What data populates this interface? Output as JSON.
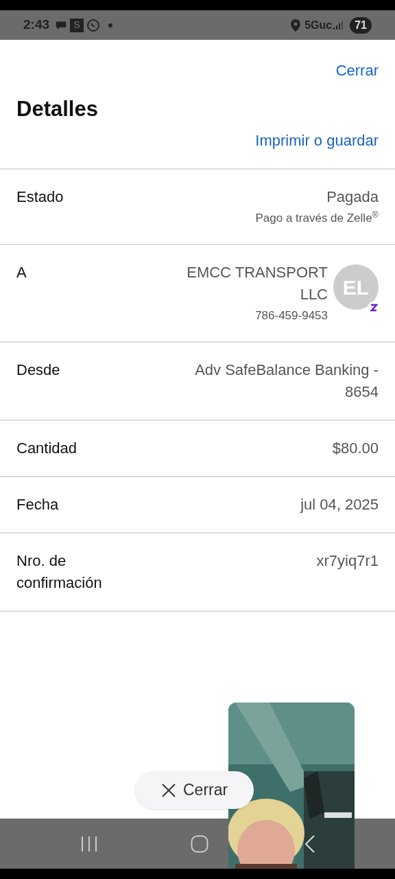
{
  "status_bar": {
    "time": "2:43",
    "notification_letter": "S",
    "network": "5Guc",
    "battery": "71"
  },
  "header": {
    "close": "Cerrar",
    "title": "Detalles",
    "print": "Imprimir o guardar"
  },
  "rows": [
    {
      "label": "Estado",
      "value": "Pagada",
      "note": "Pago a través de Zelle$^{®}$"
    },
    {
      "label": "A",
      "value": "EMCC TRANSPORT LLC",
      "note": "786-459-9453",
      "avatar": "EL"
    },
    {
      "label": "Desde",
      "value": "Adv SafeBalance Banking - 8654"
    },
    {
      "label": "Cantidad",
      "value": "$80.00"
    },
    {
      "label": "Fecha",
      "value": "jul 04, 2025"
    },
    {
      "label": "Nro. de confirmación",
      "value": "xr7yiq7r1"
    }
  ],
  "floating_close": "Cerrar"
}
